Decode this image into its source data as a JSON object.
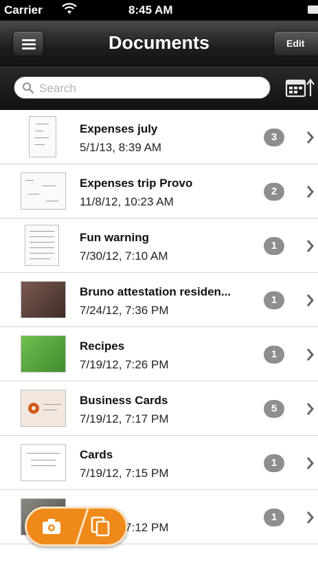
{
  "status_bar": {
    "carrier": "Carrier",
    "time": "8:45 AM"
  },
  "nav": {
    "title": "Documents",
    "edit_label": "Edit"
  },
  "search": {
    "placeholder": "Search"
  },
  "documents": [
    {
      "title": "Expenses july",
      "date": "5/1/13, 8:39 AM",
      "count": "3"
    },
    {
      "title": "Expenses trip Provo",
      "date": "11/8/12, 10:23 AM",
      "count": "2"
    },
    {
      "title": "Fun warning",
      "date": "7/30/12, 7:10 AM",
      "count": "1"
    },
    {
      "title": "Bruno attestation residen...",
      "date": "7/24/12, 7:36 PM",
      "count": "1"
    },
    {
      "title": "Recipes",
      "date": "7/19/12, 7:26 PM",
      "count": "1"
    },
    {
      "title": "Business Cards",
      "date": "7/19/12, 7:17 PM",
      "count": "5"
    },
    {
      "title": "Cards",
      "date": "7/19/12, 7:15 PM",
      "count": "1"
    },
    {
      "title": "",
      "date": "7/19/12, 7:12 PM",
      "count": "1"
    }
  ],
  "colors": {
    "accent": "#ef8a1a",
    "badge": "#8e8e8e",
    "navbar": "#1d1d1d"
  }
}
